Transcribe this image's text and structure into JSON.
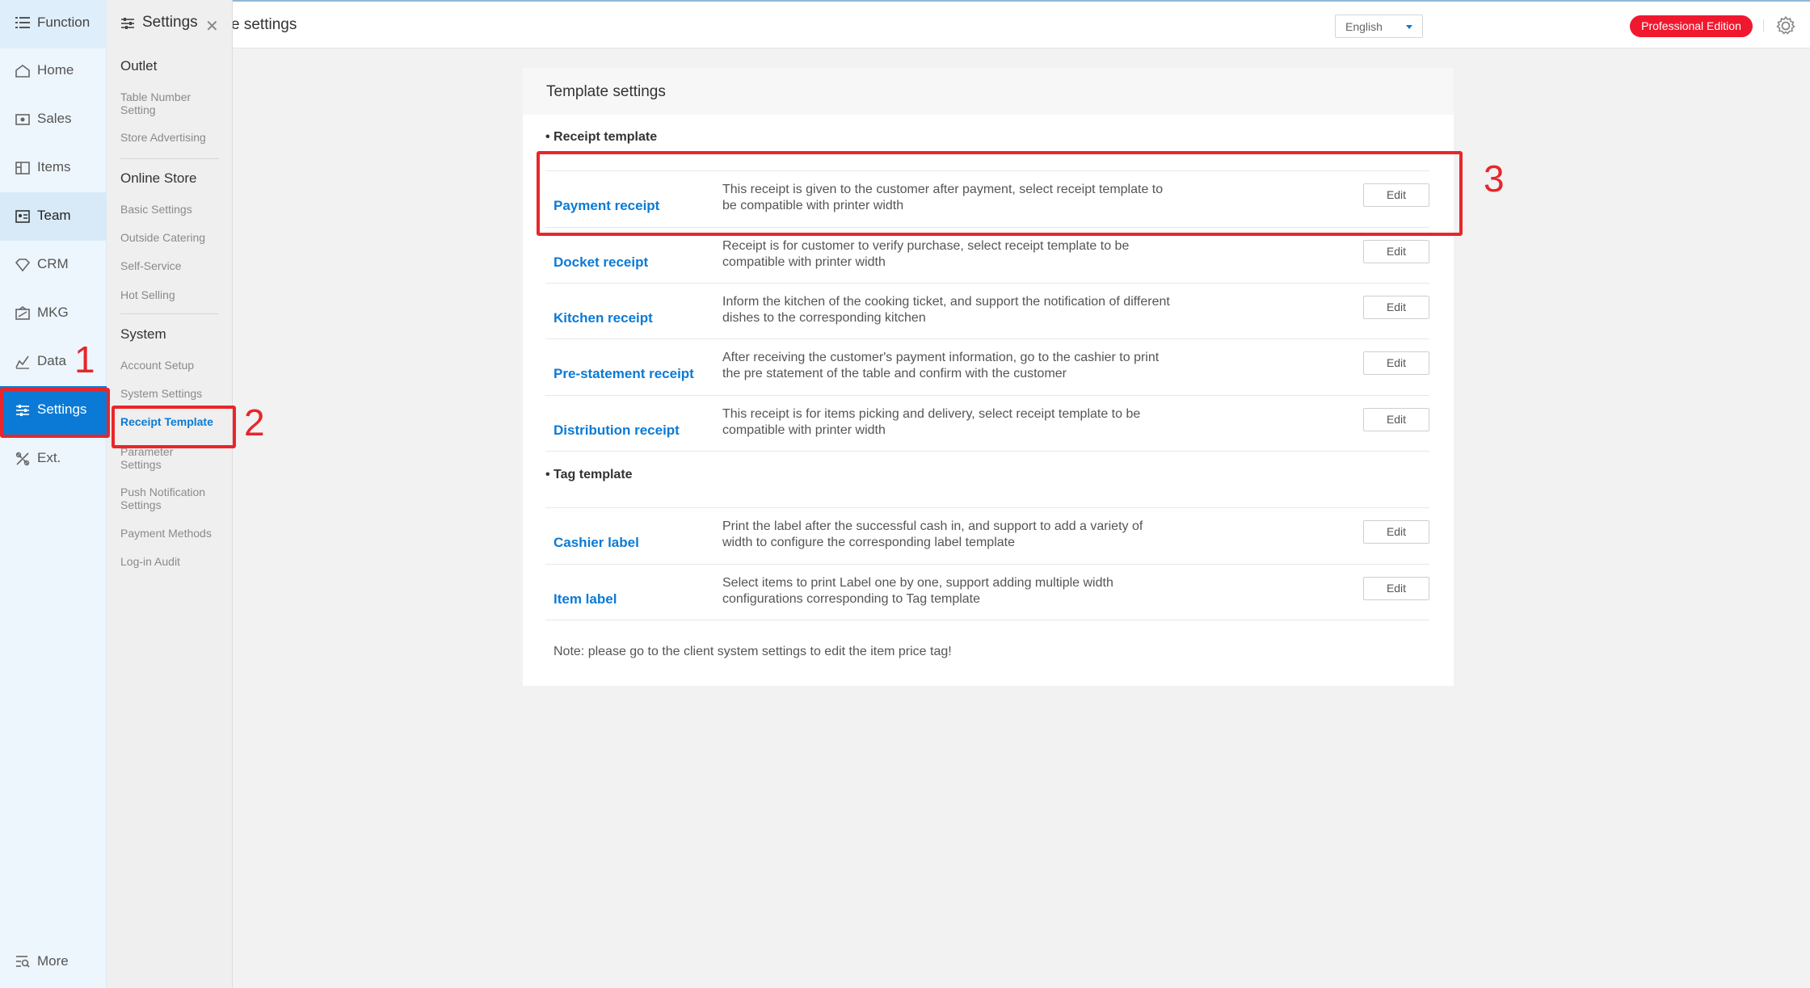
{
  "header": {
    "page_title": "e settings",
    "language": "English",
    "edition_badge": "Professional Edition"
  },
  "leftnav": {
    "function_label": "Function",
    "items": [
      {
        "label": "Home",
        "icon": "home-icon"
      },
      {
        "label": "Sales",
        "icon": "sales-icon"
      },
      {
        "label": "Items",
        "icon": "items-icon"
      },
      {
        "label": "Team",
        "icon": "team-icon"
      },
      {
        "label": "CRM",
        "icon": "crm-icon"
      },
      {
        "label": "MKG",
        "icon": "mkg-icon"
      },
      {
        "label": "Data",
        "icon": "data-icon"
      },
      {
        "label": "Settings",
        "icon": "settings-icon"
      },
      {
        "label": "Ext.",
        "icon": "ext-icon"
      }
    ],
    "more_label": "More"
  },
  "submenu": {
    "title": "Settings",
    "groups": [
      {
        "title": "Outlet",
        "links": [
          "Table Number Setting",
          "Store Advertising"
        ]
      },
      {
        "title": "Online Store",
        "links": [
          "Basic Settings",
          "Outside Catering",
          "Self-Service",
          "Hot Selling"
        ]
      },
      {
        "title": "System",
        "links": [
          "Account Setup",
          "System Settings",
          "Receipt Template",
          "Parameter Settings",
          "Push Notification Settings",
          "Payment Methods",
          "Log-in Audit"
        ]
      }
    ]
  },
  "main": {
    "card_title": "Template settings",
    "receipt_section": "• Receipt template",
    "tag_section": "• Tag template",
    "edit_label": "Edit",
    "receipt_rows": [
      {
        "name": "Payment receipt",
        "desc": "This receipt is given to the customer after payment, select receipt template to be compatible with printer width"
      },
      {
        "name": "Docket receipt",
        "desc": "Receipt is for customer to verify purchase, select receipt template to be compatible with printer width"
      },
      {
        "name": "Kitchen receipt",
        "desc": "Inform the kitchen of the cooking ticket, and support the notification of different dishes to the corresponding kitchen"
      },
      {
        "name": "Pre-statement receipt",
        "desc": "After receiving the customer's payment information, go to the cashier to print the pre statement of the table and confirm with the customer"
      },
      {
        "name": "Distribution receipt",
        "desc": "This receipt is for items picking and delivery, select receipt template to be compatible with printer width"
      }
    ],
    "tag_rows": [
      {
        "name": "Cashier label",
        "desc": "Print the label after the successful cash in, and support to add a variety of width to configure the corresponding label template"
      },
      {
        "name": "Item label",
        "desc": "Select items to print Label one by one, support adding multiple width configurations corresponding to Tag template"
      }
    ],
    "note": "Note: please go to the client system settings to edit the item price tag!"
  },
  "annotations": [
    "1",
    "2",
    "3"
  ],
  "colors": {
    "accent": "#0a7ad6",
    "badge": "#f0182e",
    "annotation": "#e8262b"
  }
}
